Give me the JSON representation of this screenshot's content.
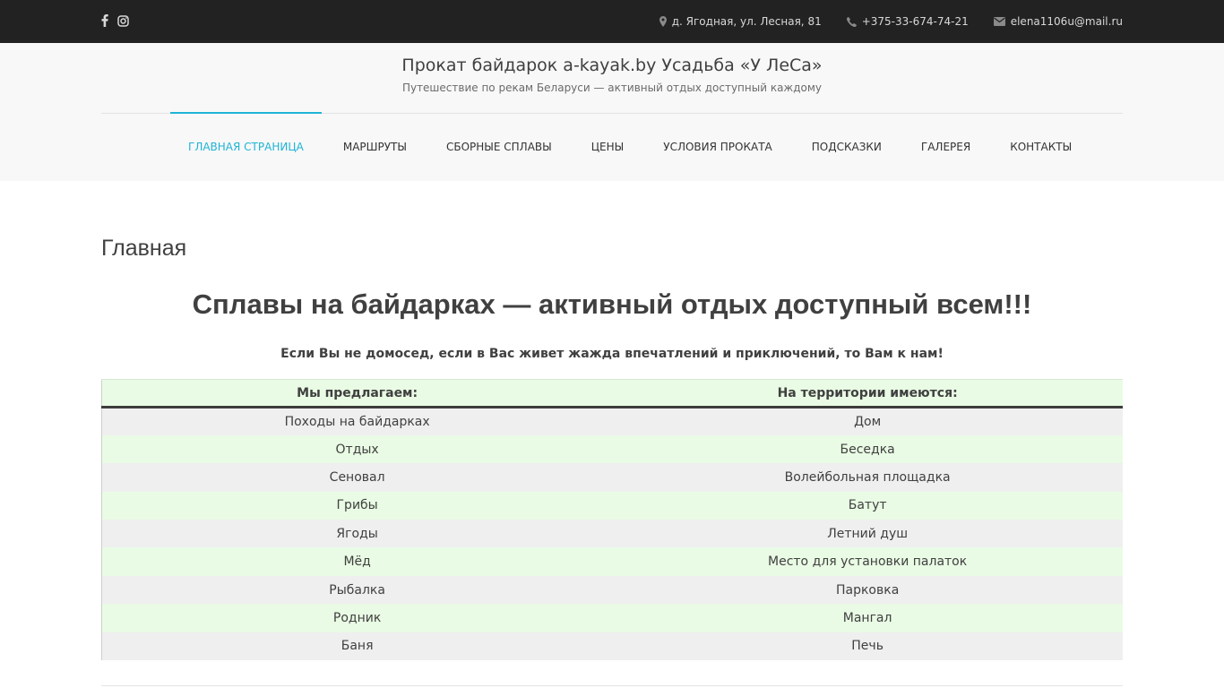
{
  "topbar": {
    "social": [
      "facebook-icon",
      "instagram-icon"
    ],
    "address": "д. Ягодная, ул. Лесная, 81",
    "phone": "+375-33-674-74-21",
    "email": "elena1106u@mail.ru"
  },
  "header": {
    "site_title": "Прокат байдарок a-kayak.by Усадьба «У ЛеСа»",
    "site_description": "Путешествие по рекам Беларуси — активный отдых доступный каждому"
  },
  "nav": {
    "items": [
      {
        "label": "Главная страница",
        "active": true
      },
      {
        "label": "Маршруты",
        "active": false
      },
      {
        "label": "Сборные сплавы",
        "active": false
      },
      {
        "label": "Цены",
        "active": false
      },
      {
        "label": "Условия проката",
        "active": false
      },
      {
        "label": "Подсказки",
        "active": false
      },
      {
        "label": "Галерея",
        "active": false
      },
      {
        "label": "Контакты",
        "active": false
      }
    ]
  },
  "main": {
    "page_title": "Главная",
    "hero": "Сплавы на байдарках — активный отдых доступный всем!!!",
    "intro": "Если Вы не домосед, если в Вас живет жажда впечатлений и приключений, то Вам к нам!",
    "table": {
      "headers": [
        "Мы предлагаем:",
        "На территории имеются:"
      ],
      "rows": [
        [
          "Походы на байдарках",
          "Дом"
        ],
        [
          "Отдых",
          "Беседка"
        ],
        [
          "Сеновал",
          "Волейбольная площадка"
        ],
        [
          "Грибы",
          "Батут"
        ],
        [
          "Ягоды",
          "Летний душ"
        ],
        [
          "Мёд",
          "Место для установки палаток"
        ],
        [
          "Рыбалка",
          "Парковка"
        ],
        [
          "Родник",
          "Мангал"
        ],
        [
          "Баня",
          "Печь"
        ]
      ]
    }
  },
  "colors": {
    "topbar_bg": "#222222",
    "accent": "#1fb4d6",
    "header_bg": "#f8f8f8",
    "row_green": "#e9fbe4",
    "row_gray": "#efefef"
  }
}
